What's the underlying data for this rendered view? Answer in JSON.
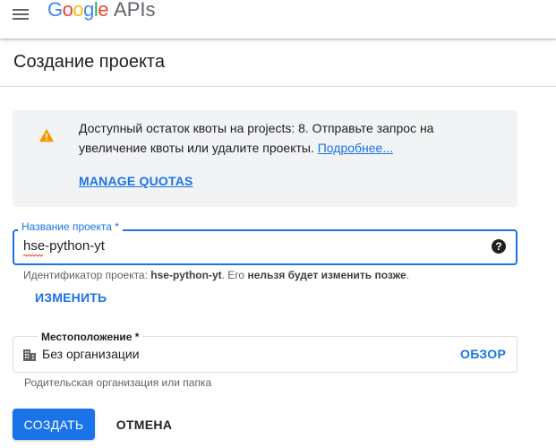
{
  "header": {
    "menu_icon": "hamburger-menu-icon",
    "logo_google_letters": [
      "G",
      "o",
      "o",
      "g",
      "l",
      "e"
    ],
    "logo_apis": "APIs"
  },
  "page": {
    "title": "Создание проекта"
  },
  "notice": {
    "icon": "warning-icon",
    "text": "Доступный остаток квоты на projects: 8. Отправьте запрос на увеличение квоты или удалите проекты.",
    "link": "Подробнее...",
    "action": "MANAGE QUOTAS",
    "warning_color": "#F29900"
  },
  "project_name": {
    "label": "Название проекта *",
    "value": "hse-python-yt",
    "help_icon": "help-icon",
    "hint_prefix": "Идентификатор проекта:",
    "hint_id": "hse-python-yt",
    "hint_mid": ". Его",
    "hint_bold": "нельзя будет изменить позже",
    "hint_end": ".",
    "change_label": "ИЗМЕНИТЬ"
  },
  "location": {
    "label": "Местоположение *",
    "icon": "organization-building-icon",
    "value": "Без организации",
    "browse_label": "ОБЗОР",
    "hint": "Родительская организация или папка"
  },
  "actions": {
    "create_label": "СОЗДАТЬ",
    "cancel_label": "ОТМЕНА"
  },
  "colors": {
    "accent": "#1a73e8",
    "notice_background": "#f1f3f4"
  }
}
